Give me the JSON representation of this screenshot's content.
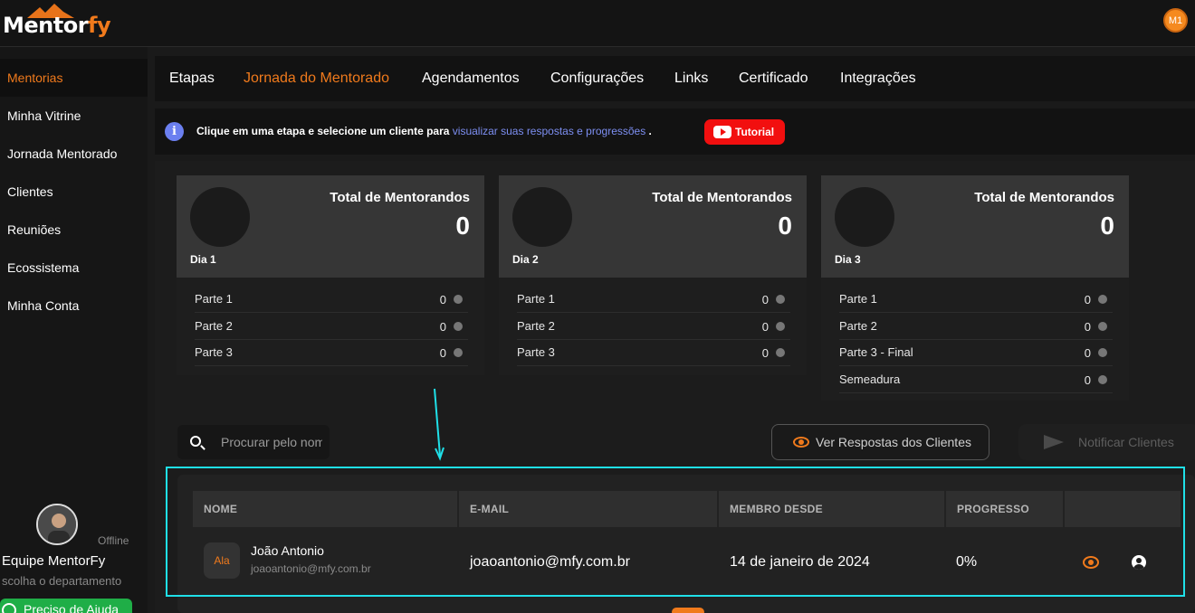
{
  "app": {
    "logo_part1": "Mentor",
    "logo_part2": "fy",
    "user_initials": "M1"
  },
  "colors": {
    "accent": "#f07a1c",
    "link": "#7d8ff2",
    "tutorial": "#f20f0f",
    "help": "#1fae47",
    "highlight": "#1fe0e8"
  },
  "sidebar": {
    "items": [
      {
        "label": "Mentorias",
        "active": true
      },
      {
        "label": "Minha Vitrine"
      },
      {
        "label": "Jornada Mentorado"
      },
      {
        "label": "Clientes"
      },
      {
        "label": "Reuniões"
      },
      {
        "label": "Ecossistema"
      },
      {
        "label": "Minha Conta"
      }
    ],
    "support": {
      "status": "Offline",
      "name": "Equipe MentorFy",
      "department": "scolha o departamento",
      "help_label": "Preciso de Ajuda"
    }
  },
  "tabs": [
    {
      "label": "Etapas"
    },
    {
      "label": "Jornada do Mentorado",
      "active": true
    },
    {
      "label": "Agendamentos"
    },
    {
      "label": "Configurações"
    },
    {
      "label": "Links"
    },
    {
      "label": "Certificado"
    },
    {
      "label": "Integrações"
    }
  ],
  "info": {
    "text_before": "Clique em uma etapa e selecione um cliente para ",
    "link_text": "visualizar suas respostas e progressões",
    "text_after": " .",
    "tutorial_label": "Tutorial"
  },
  "cards": [
    {
      "day": "Dia 1",
      "title": "Total de Mentorandos",
      "total": "0",
      "parts": [
        {
          "label": "Parte 1",
          "value": "0"
        },
        {
          "label": "Parte 2",
          "value": "0"
        },
        {
          "label": "Parte 3",
          "value": "0"
        }
      ]
    },
    {
      "day": "Dia 2",
      "title": "Total de Mentorandos",
      "total": "0",
      "parts": [
        {
          "label": "Parte 1",
          "value": "0"
        },
        {
          "label": "Parte 2",
          "value": "0"
        },
        {
          "label": "Parte 3",
          "value": "0"
        }
      ]
    },
    {
      "day": "Dia 3",
      "title": "Total de Mentorandos",
      "total": "0",
      "parts": [
        {
          "label": "Parte 1",
          "value": "0"
        },
        {
          "label": "Parte 2",
          "value": "0"
        },
        {
          "label": "Parte 3 - Final",
          "value": "0"
        },
        {
          "label": "Semeadura",
          "value": "0"
        }
      ]
    }
  ],
  "search": {
    "placeholder": "Procurar pelo nome"
  },
  "actions": {
    "view_label": "Ver Respostas dos Clientes",
    "notify_label": "Notificar Clientes"
  },
  "table": {
    "headers": [
      "NOME",
      "E-MAIL",
      "MEMBRO DESDE",
      "PROGRESSO"
    ],
    "rows": [
      {
        "avatar": "Ala",
        "name": "João Antonio",
        "sub_email": "joaoantonio@mfy.com.br",
        "email": "joaoantonio@mfy.com.br",
        "since": "14 de janeiro de 2024",
        "progress": "0%"
      }
    ]
  }
}
